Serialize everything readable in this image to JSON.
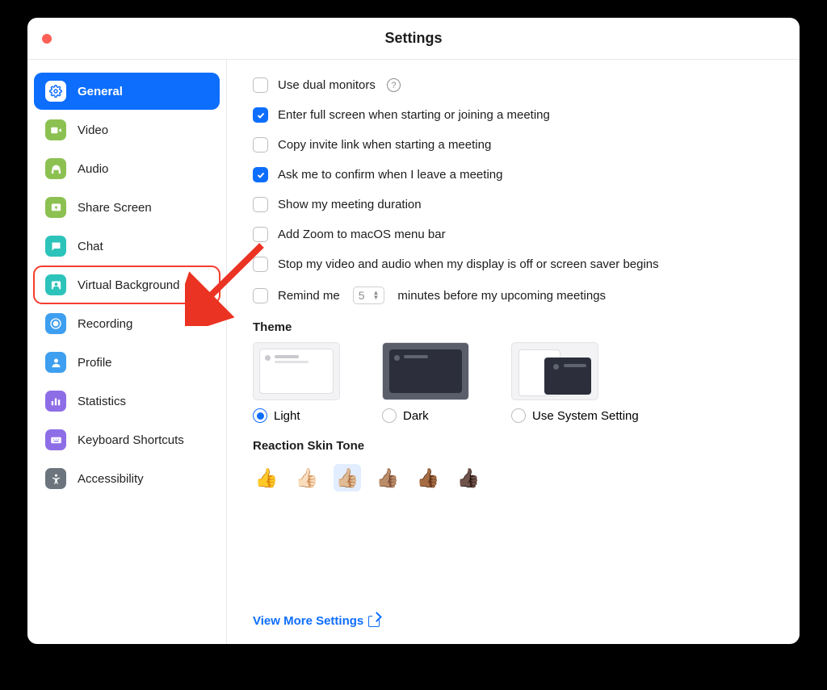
{
  "window": {
    "title": "Settings"
  },
  "sidebar": {
    "items": [
      {
        "label": "General"
      },
      {
        "label": "Video"
      },
      {
        "label": "Audio"
      },
      {
        "label": "Share Screen"
      },
      {
        "label": "Chat"
      },
      {
        "label": "Virtual Background"
      },
      {
        "label": "Recording"
      },
      {
        "label": "Profile"
      },
      {
        "label": "Statistics"
      },
      {
        "label": "Keyboard Shortcuts"
      },
      {
        "label": "Accessibility"
      }
    ]
  },
  "general": {
    "options": [
      {
        "label": "Use dual monitors",
        "checked": false,
        "help": true
      },
      {
        "label": "Enter full screen when starting or joining a meeting",
        "checked": true
      },
      {
        "label": "Copy invite link when starting a meeting",
        "checked": false
      },
      {
        "label": "Ask me to confirm when I leave a meeting",
        "checked": true
      },
      {
        "label": "Show my meeting duration",
        "checked": false
      },
      {
        "label": "Add Zoom to macOS menu bar",
        "checked": false
      },
      {
        "label": "Stop my video and audio when my display is off or screen saver begins",
        "checked": false
      }
    ],
    "remind": {
      "pre": "Remind me",
      "value": "5",
      "post": "minutes before my upcoming meetings",
      "checked": false
    },
    "theme_title": "Theme",
    "themes": [
      {
        "label": "Light",
        "selected": true
      },
      {
        "label": "Dark",
        "selected": false
      },
      {
        "label": "Use System Setting",
        "selected": false
      }
    ],
    "skin_title": "Reaction Skin Tone",
    "skins": [
      "👍",
      "👍🏻",
      "👍🏼",
      "👍🏽",
      "👍🏾",
      "👍🏿"
    ],
    "skin_selected_index": 2,
    "link": "View More Settings"
  }
}
